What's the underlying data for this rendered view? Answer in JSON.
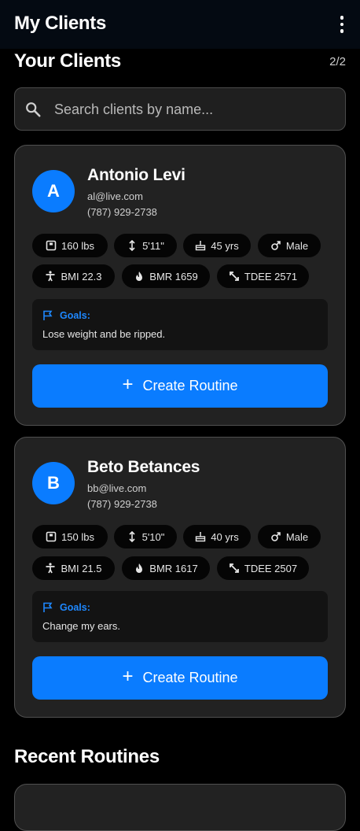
{
  "appbar": {
    "title": "My Clients",
    "more_icon": "more-vert-icon"
  },
  "clients_section": {
    "title": "Your Clients",
    "count": "2/2"
  },
  "search": {
    "placeholder": "Search clients by name...",
    "value": ""
  },
  "clients": [
    {
      "initial": "A",
      "name": "Antonio Levi",
      "email": "al@live.com",
      "phone": "(787) 929-2738",
      "weight": "160 lbs",
      "height": "5'11\"",
      "age": "45 yrs",
      "sex": "Male",
      "bmi": "BMI 22.3",
      "bmr": "BMR 1659",
      "tdee": "TDEE 2571",
      "goals_label": "Goals:",
      "goals": "Lose weight and be ripped.",
      "button": "Create Routine"
    },
    {
      "initial": "B",
      "name": "Beto Betances",
      "email": "bb@live.com",
      "phone": "(787) 929-2738",
      "weight": "150 lbs",
      "height": "5'10\"",
      "age": "40 yrs",
      "sex": "Male",
      "bmi": "BMI 21.5",
      "bmr": "BMR 1617",
      "tdee": "TDEE 2507",
      "goals_label": "Goals:",
      "goals": "Change my ears.",
      "button": "Create Routine"
    }
  ],
  "routines_section": {
    "title": "Recent Routines"
  },
  "colors": {
    "accent": "#0a7cff",
    "card": "#222222",
    "background": "#000000",
    "goals_label": "#1e88ff"
  }
}
